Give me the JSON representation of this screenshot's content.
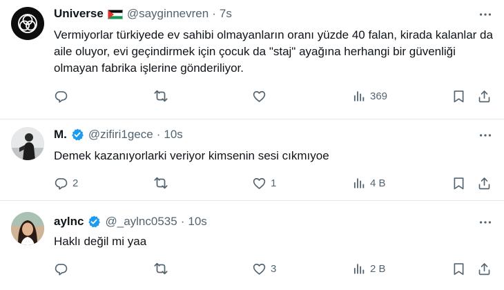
{
  "tweets": [
    {
      "name": "Universe",
      "flag": "palestine-flag",
      "verified": false,
      "handle": "@sayginnevren",
      "dot": "·",
      "time": "7s",
      "text": "Vermiyorlar türkiyede ev sahibi olmayanların oranı yüzde 40 falan, kirada kalanlar da aile oluyor, evi geçindirmek için çocuk da \"staj\" ayağına herhangi bir güvenliği olmayan fabrika işlerine gönderiliyor.",
      "replies": "",
      "retweets": "",
      "likes": "",
      "views": "369"
    },
    {
      "name": "M.",
      "verified": true,
      "handle": "@zifiri1gece",
      "dot": "·",
      "time": "10s",
      "text": "Demek kazanıyorlarki veriyor kimsenin sesi cıkmıyoe",
      "replies": "2",
      "retweets": "",
      "likes": "1",
      "views": "4 B"
    },
    {
      "name": "aylnc",
      "verified": true,
      "handle": "@_aylnc0535",
      "dot": "·",
      "time": "10s",
      "text": "Haklı değil mi yaa",
      "replies": "",
      "retweets": "",
      "likes": "3",
      "views": "2 B"
    }
  ],
  "icons": {
    "reply": "reply-icon",
    "retweet": "retweet-icon",
    "like": "heart-icon",
    "views": "views-bar-chart-icon",
    "bookmark": "bookmark-icon",
    "share": "share-icon",
    "more": "more-dots-icon",
    "verified": "verified-badge-icon"
  },
  "colors": {
    "text": "#0f1419",
    "secondary": "#536471",
    "verified": "#1d9bf0",
    "divider": "#e4e8eb"
  }
}
